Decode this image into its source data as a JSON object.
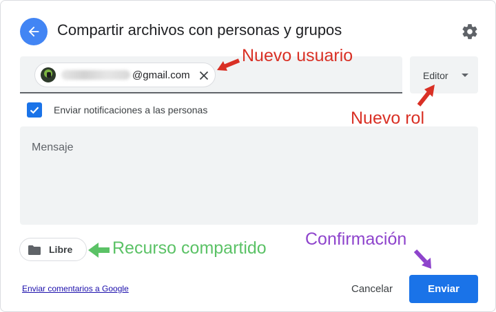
{
  "dialog": {
    "title": "Compartir archivos con personas y grupos"
  },
  "recipient": {
    "email_suffix": "@gmail.com",
    "avatar": "user-avatar"
  },
  "role": {
    "label": "Editor"
  },
  "notify": {
    "checked": true,
    "label": "Enviar notificaciones a las personas"
  },
  "message": {
    "placeholder": "Mensaje"
  },
  "drive": {
    "label": "Libre",
    "icon": "folder-icon"
  },
  "footer": {
    "feedback_link": "Enviar comentarios a Google",
    "cancel_label": "Cancelar",
    "send_label": "Enviar"
  },
  "annotations": {
    "new_user": "Nuevo usuario",
    "new_role": "Nuevo rol",
    "shared_resource": "Recurso compartido",
    "confirmation": "Confirmación"
  },
  "colors": {
    "accent": "#1a73e8",
    "annotation_red": "#d93025",
    "annotation_green": "#5bc266",
    "annotation_purple": "#8e44cc"
  }
}
